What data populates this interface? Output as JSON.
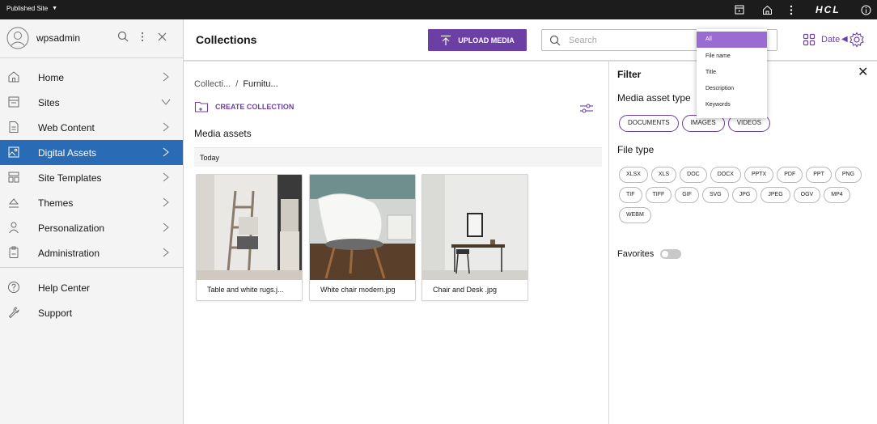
{
  "topbar": {
    "site_selector": "Published Site",
    "brand": "HCL",
    "icons": [
      "preview-icon",
      "home-icon",
      "more-vertical-icon",
      "info-icon"
    ]
  },
  "sidebar": {
    "username": "wpsadmin",
    "tools": [
      "search-icon",
      "more-vertical-icon",
      "close-icon"
    ],
    "items": [
      {
        "label": "Home",
        "icon": "home-icon",
        "chevron": "right"
      },
      {
        "label": "Sites",
        "icon": "site-icon",
        "chevron": "down"
      },
      {
        "label": "Web Content",
        "icon": "document-icon",
        "chevron": "right"
      },
      {
        "label": "Digital Assets",
        "icon": "image-icon",
        "chevron": "right",
        "active": true
      },
      {
        "label": "Site Templates",
        "icon": "template-icon",
        "chevron": "right"
      },
      {
        "label": "Themes",
        "icon": "paint-icon",
        "chevron": "right"
      },
      {
        "label": "Personalization",
        "icon": "person-icon",
        "chevron": "right"
      },
      {
        "label": "Administration",
        "icon": "clipboard-icon",
        "chevron": "right"
      }
    ],
    "secondary": [
      {
        "label": "Help Center",
        "icon": "help-icon"
      },
      {
        "label": "Support",
        "icon": "wrench-icon"
      }
    ]
  },
  "header": {
    "title": "Collections",
    "upload_label": "UPLOAD MEDIA",
    "search_placeholder": "Search",
    "sort_label": "Date"
  },
  "search_dropdown": {
    "options": [
      "All",
      "File name",
      "Title",
      "Description",
      "Keywords"
    ],
    "selected": "All"
  },
  "main": {
    "breadcrumb": [
      "Collecti...",
      "Furnitu..."
    ],
    "breadcrumb_sep": "/",
    "create_label": "CREATE COLLECTION",
    "section_title": "Media assets",
    "group_label": "Today",
    "assets": [
      {
        "name": "Table and white rugs.j..."
      },
      {
        "name": "White chair modern.jpg"
      },
      {
        "name": "Chair and Desk .jpg"
      }
    ]
  },
  "filter": {
    "title": "Filter",
    "media_type_label": "Media asset type",
    "media_types": [
      "DOCUMENTS",
      "IMAGES",
      "VIDEOS"
    ],
    "file_type_label": "File type",
    "file_types": [
      "XLSX",
      "XLS",
      "DOC",
      "DOCX",
      "PPTX",
      "PDF",
      "PPT",
      "PNG",
      "TIF",
      "TIFF",
      "GIF",
      "SVG",
      "JPG",
      "JPEG",
      "OGV",
      "MP4",
      "WEBM"
    ],
    "favorites_label": "Favorites"
  },
  "colors": {
    "accent": "#6c3fa5",
    "nav_active": "#2a6bb5",
    "topbar": "#1c1c1c",
    "dropdown_selected": "#9a6bd1"
  }
}
